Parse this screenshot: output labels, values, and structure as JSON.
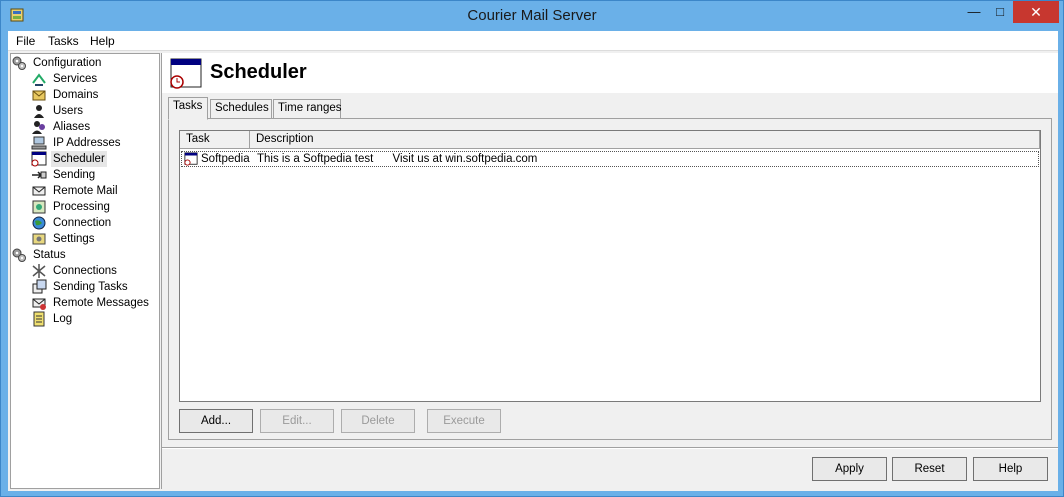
{
  "window": {
    "title": "Courier Mail Server"
  },
  "menu": {
    "file": "File",
    "tasks": "Tasks",
    "help": "Help"
  },
  "tree": {
    "configuration": "Configuration",
    "services": "Services",
    "domains": "Domains",
    "users": "Users",
    "aliases": "Aliases",
    "ip_addresses": "IP Addresses",
    "scheduler": "Scheduler",
    "sending": "Sending",
    "remote_mail": "Remote Mail",
    "processing": "Processing",
    "connection": "Connection",
    "settings": "Settings",
    "status": "Status",
    "connections": "Connections",
    "sending_tasks": "Sending Tasks",
    "remote_messages": "Remote Messages",
    "log": "Log"
  },
  "panel": {
    "title": "Scheduler",
    "tabs": [
      "Tasks",
      "Schedules",
      "Time ranges"
    ],
    "columns": [
      "Task",
      "Description"
    ],
    "rows": [
      {
        "task": "Softpedia",
        "description": "This is a Softpedia test      Visit us at win.softpedia.com"
      }
    ],
    "buttons": {
      "add": "Add...",
      "edit": "Edit...",
      "delete": "Delete",
      "execute": "Execute"
    }
  },
  "footer": {
    "apply": "Apply",
    "reset": "Reset",
    "help": "Help"
  }
}
